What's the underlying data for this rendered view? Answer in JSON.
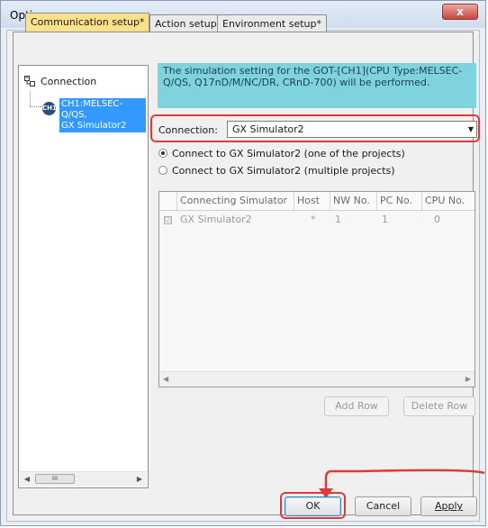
{
  "window": {
    "title": "Option",
    "close_glyph": "x"
  },
  "tabs": [
    {
      "label": "Communication setup*"
    },
    {
      "label": "Action setup"
    },
    {
      "label": "Environment setup*"
    }
  ],
  "tree": {
    "root_label": "Connection",
    "child_label_line1": "CH1:MELSEC-Q/QS,",
    "child_label_line2": "GX Simulator2",
    "child_icon_text": "CH1",
    "scroll_left": "◀",
    "scroll_thumb": "III",
    "scroll_right": "▶"
  },
  "info_text": "The simulation setting for the GOT-[CH1](CPU Type:MELSEC-Q/QS, Q17nD/M/NC/DR, CRnD-700) will be performed.",
  "connection": {
    "label": "Connection:",
    "value": "GX Simulator2",
    "dropdown_glyph": "▼"
  },
  "radios": [
    {
      "label": "Connect to GX Simulator2 (one of the projects)",
      "selected": true
    },
    {
      "label": "Connect to GX Simulator2 (multiple projects)",
      "selected": false
    }
  ],
  "grid": {
    "columns": [
      "Connecting Simulator",
      "Host",
      "NW No.",
      "PC No.",
      "CPU No."
    ],
    "rows": [
      {
        "check": "☑",
        "simulator": "GX Simulator2",
        "host": "*",
        "nw": "1",
        "pc": "1",
        "cpu": "0"
      }
    ],
    "scroll_left": "◀",
    "scroll_right": "▶"
  },
  "buttons": {
    "add_row": "Add Row",
    "delete_row": "Delete Row",
    "ok": "OK",
    "cancel": "Cancel",
    "apply": "Apply"
  },
  "colors": {
    "active_tab": "#fde08a",
    "info_bg": "#7fd3dc",
    "highlight": "#e03a3a",
    "selection": "#3399ff"
  }
}
